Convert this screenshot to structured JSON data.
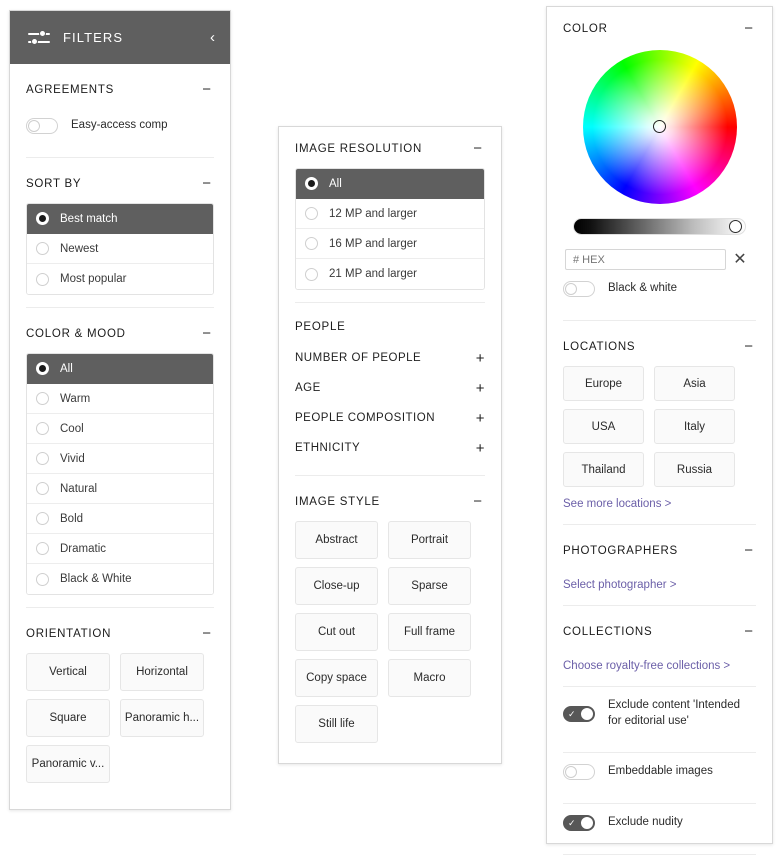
{
  "left_panel": {
    "header": {
      "title": "FILTERS",
      "icon": "sliders-icon",
      "collapse_icon": "chevron-left-icon",
      "bg": "#5f5f5f"
    },
    "sections": [
      {
        "id": "agreements",
        "title": "AGREEMENTS",
        "toggler": "−",
        "switches": [
          {
            "label": "Easy-access comp",
            "on": false
          }
        ]
      },
      {
        "id": "sort-by",
        "title": "SORT BY",
        "toggler": "−",
        "options": [
          {
            "label": "Best match",
            "selected": true
          },
          {
            "label": "Newest",
            "selected": false
          },
          {
            "label": "Most popular",
            "selected": false
          }
        ]
      },
      {
        "id": "color-mood",
        "title": "COLOR & MOOD",
        "toggler": "−",
        "options": [
          {
            "label": "All",
            "selected": true
          },
          {
            "label": "Warm",
            "selected": false
          },
          {
            "label": "Cool",
            "selected": false
          },
          {
            "label": "Vivid",
            "selected": false
          },
          {
            "label": "Natural",
            "selected": false
          },
          {
            "label": "Bold",
            "selected": false
          },
          {
            "label": "Dramatic",
            "selected": false
          },
          {
            "label": "Black & White",
            "selected": false
          }
        ]
      },
      {
        "id": "orientation",
        "title": "ORIENTATION",
        "toggler": "−",
        "chips": [
          "Vertical",
          "Horizontal",
          "Square",
          "Panoramic h...",
          "Panoramic v..."
        ]
      }
    ]
  },
  "mid_panel": {
    "sections": [
      {
        "id": "image-resolution",
        "title": "IMAGE RESOLUTION",
        "toggler": "−",
        "options": [
          {
            "label": "All",
            "selected": true
          },
          {
            "label": "12 MP and larger",
            "selected": false
          },
          {
            "label": "16 MP and larger",
            "selected": false
          },
          {
            "label": "21 MP and larger",
            "selected": false
          }
        ]
      },
      {
        "id": "people",
        "title": "PEOPLE",
        "expandables": [
          {
            "label": "NUMBER OF PEOPLE",
            "toggler": "+"
          },
          {
            "label": "AGE",
            "toggler": "+"
          },
          {
            "label": "PEOPLE COMPOSITION",
            "toggler": "+"
          },
          {
            "label": "ETHNICITY",
            "toggler": "+"
          }
        ]
      },
      {
        "id": "image-style",
        "title": "IMAGE STYLE",
        "toggler": "−",
        "chips": [
          "Abstract",
          "Portrait",
          "Close-up",
          "Sparse",
          "Cut out",
          "Full frame",
          "Copy space",
          "Macro",
          "Still life"
        ]
      }
    ]
  },
  "right_panel": {
    "color": {
      "title": "COLOR",
      "toggler": "−",
      "wheel_icon": "color-wheel",
      "luminance_slider": {
        "value_pct": 95
      },
      "hex_input": {
        "value": "",
        "placeholder": "# HEX"
      },
      "clear_icon": "close-icon",
      "bw_switch": {
        "label": "Black & white",
        "on": false
      }
    },
    "locations": {
      "title": "LOCATIONS",
      "toggler": "−",
      "chips": [
        "Europe",
        "Asia",
        "USA",
        "Italy",
        "Thailand",
        "Russia"
      ],
      "link": "See more locations >"
    },
    "photographers": {
      "title": "PHOTOGRAPHERS",
      "toggler": "−",
      "link": "Select photographer >"
    },
    "collections": {
      "title": "COLLECTIONS",
      "toggler": "−",
      "link": "Choose royalty-free collections >"
    },
    "switches": [
      {
        "label": "Exclude content 'Intended for editorial use'",
        "on": true
      },
      {
        "label": "Embeddable images",
        "on": false
      },
      {
        "label": "Exclude nudity",
        "on": true
      }
    ]
  },
  "colors": {
    "header_bg": "#5f5f5f",
    "selected_row_bg": "#5f5f5f",
    "link": "#6b5fa8",
    "chip_bg": "#fafafa",
    "border": "#e3e3e3"
  }
}
